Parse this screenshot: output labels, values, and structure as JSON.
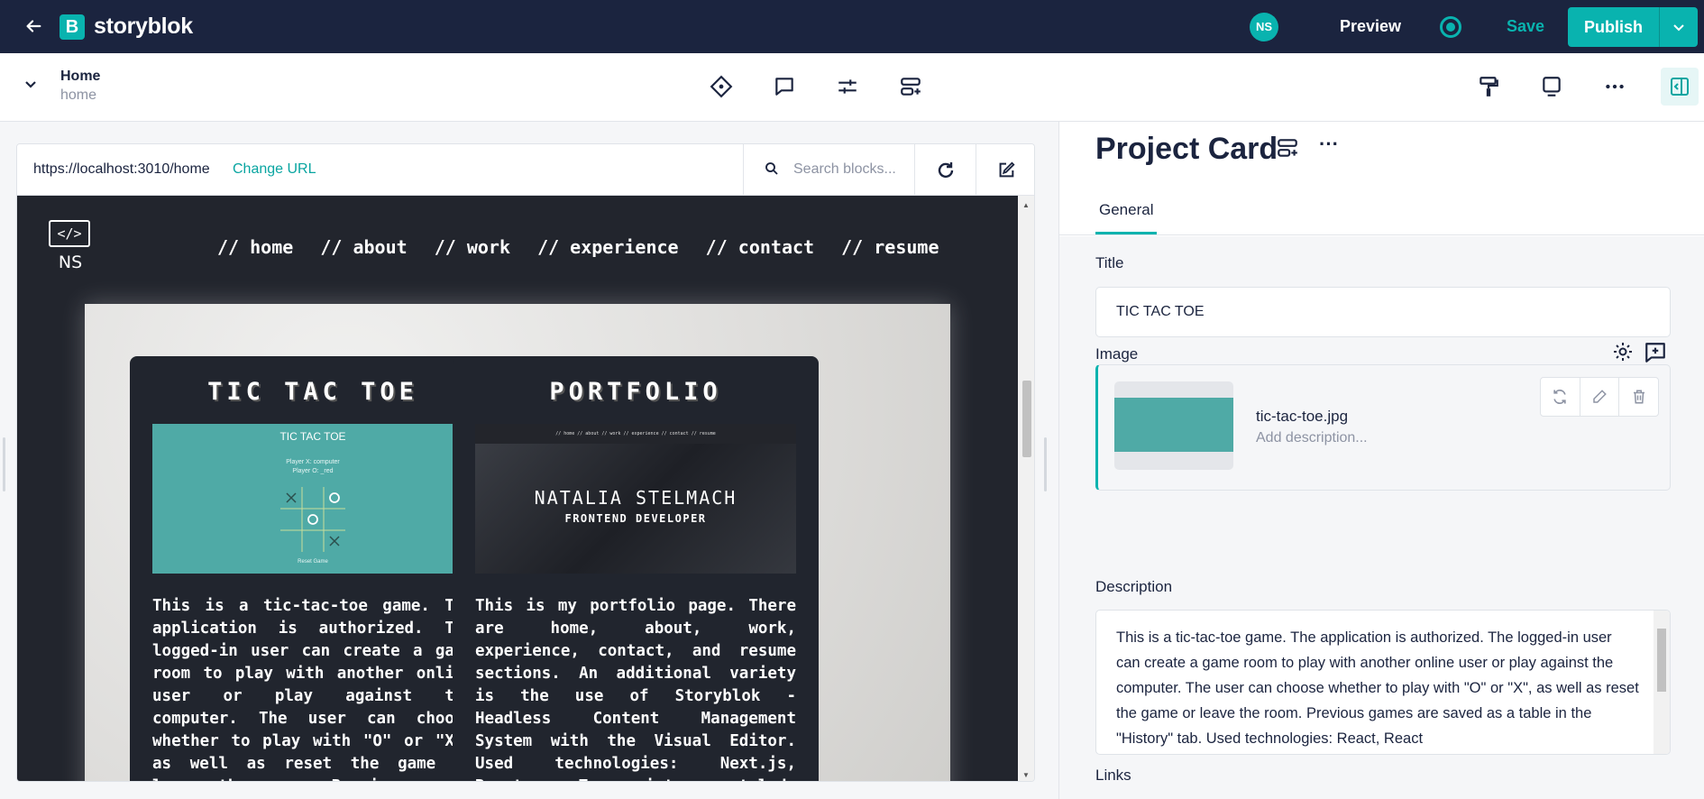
{
  "topbar": {
    "logo_letter": "B",
    "logo_text": "storyblok",
    "avatar_initials": "NS",
    "preview_label": "Preview",
    "save_label": "Save",
    "publish_label": "Publish"
  },
  "subbar": {
    "story_title": "Home",
    "story_slug": "home"
  },
  "preview": {
    "url": "https://localhost:3010/home",
    "change_url_label": "Change URL",
    "search_placeholder": "Search blocks..."
  },
  "site": {
    "logo_code": "</>",
    "logo_initials": "NS",
    "nav": [
      "// home",
      "// about",
      "// work",
      "// experience",
      "// contact",
      "// resume"
    ],
    "cards": [
      {
        "title": "TIC TAC TOE",
        "thumb_title": "TIC TAC TOE",
        "thumb_sub": [
          "Player X: computer",
          "Player O: _red"
        ],
        "thumb_reset": "Reset Game",
        "text": "This is a tic-tac-toe game. The application is authorized. The logged-in user can create a game room to play with another online user or play against the computer. The user can choose whether to play with \"O\" or \"X\", as well as reset the game or leave the room. Previous games are saved as a table in the"
      },
      {
        "title": "PORTFOLIO",
        "thumb_nav": "// home   // about   // work   // experience   // contact   // resume",
        "thumb_name": "NATALIA STELMACH",
        "thumb_role": "FRONTEND DEVELOPER",
        "text": "This is my portfolio page. There are home, about, work, experience, contact, and resume sections. An additional variety is the use of Storyblok - Headless Content Management System with the Visual Editor. Used technologies: Next.js, React, Typescript, styled-components, Storyblok."
      }
    ]
  },
  "editor": {
    "component_title": "Project Card",
    "tab_general": "General",
    "title_label": "Title",
    "title_value": "TIC TAC TOE",
    "image_label": "Image",
    "image_filename": "tic-tac-toe.jpg",
    "image_desc_placeholder": "Add description...",
    "description_label": "Description",
    "description_value": "This is a tic-tac-toe game. The application is authorized. The logged-in user can create a game room to play with another online user or play against the computer. The user can choose whether to play with \"O\" or \"X\", as well as reset the game or leave the room. Previous games are saved as a table in the \"History\" tab. Used technologies: React, React",
    "links_label": "Links"
  },
  "colors": {
    "navy": "#1b243f",
    "teal": "#09b3af",
    "site_bg": "#22252d",
    "ttt_green": "#4faaa6"
  }
}
